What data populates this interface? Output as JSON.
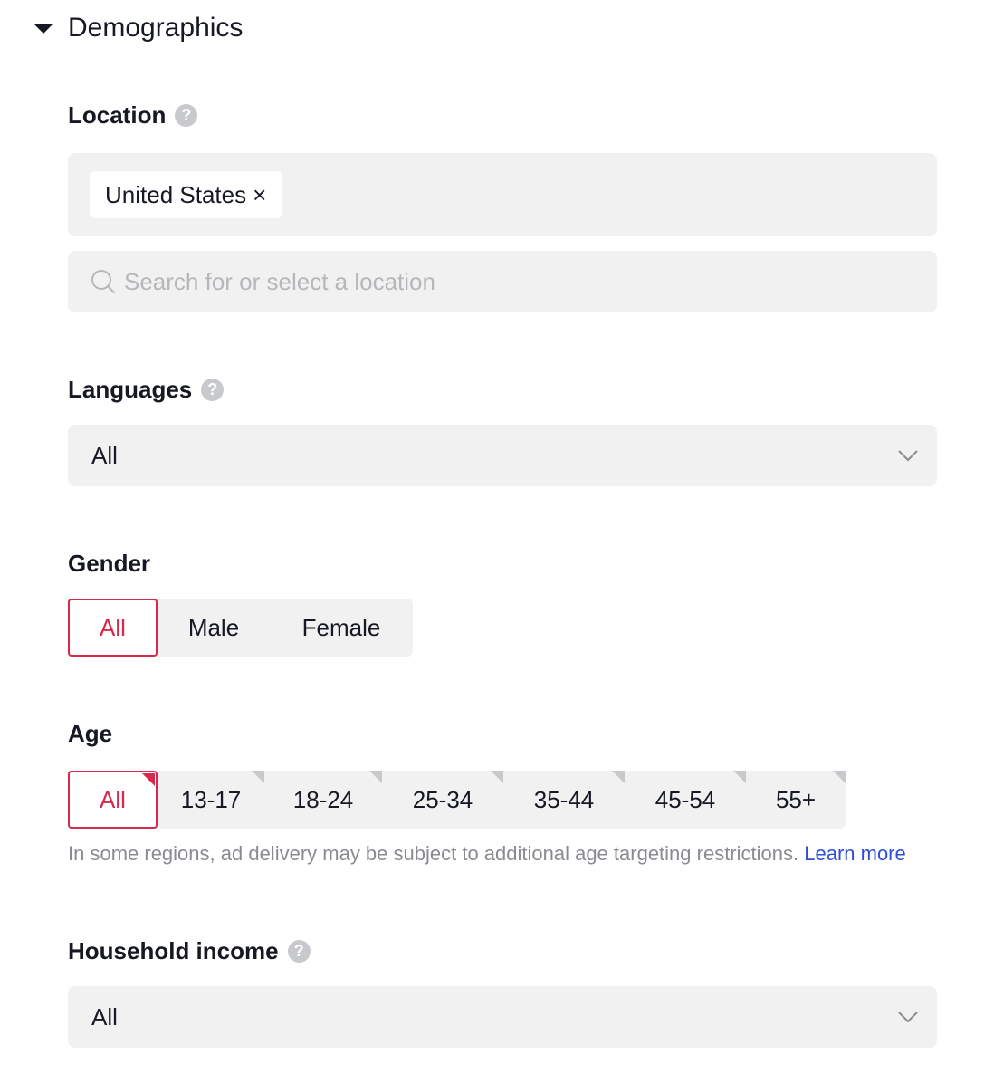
{
  "section": {
    "title": "Demographics"
  },
  "location": {
    "label": "Location",
    "help": "?",
    "selected_tag": "United States",
    "tag_remove": "×",
    "search_placeholder": "Search for or select a location"
  },
  "languages": {
    "label": "Languages",
    "help": "?",
    "value": "All"
  },
  "gender": {
    "label": "Gender",
    "options": [
      "All",
      "Male",
      "Female"
    ],
    "selected": "All"
  },
  "age": {
    "label": "Age",
    "options": [
      "All",
      "13-17",
      "18-24",
      "25-34",
      "35-44",
      "45-54",
      "55+"
    ],
    "selected": "All",
    "note": "In some regions, ad delivery may be subject to additional age targeting restrictions.",
    "learn_more": "Learn more"
  },
  "household_income": {
    "label": "Household income",
    "help": "?",
    "value": "All"
  },
  "colors": {
    "accent": "#d6294b",
    "link": "#2f4fd6",
    "field_bg": "#f1f1f2",
    "muted_text": "#8a8b91"
  }
}
